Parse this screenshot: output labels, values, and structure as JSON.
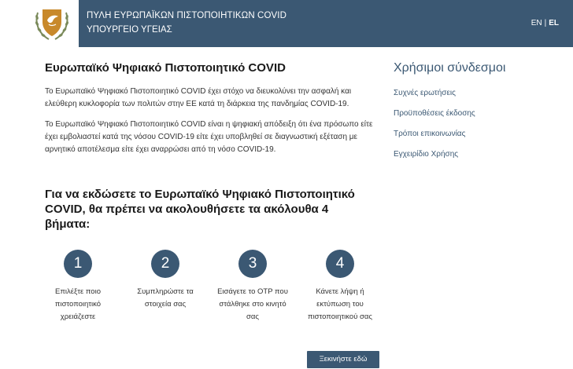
{
  "header": {
    "portal_title": "ΠΥΛΗ ΕΥΡΩΠΑΪΚΩΝ ΠΙΣΤΟΠΟΙΗΤΙΚΩΝ COVID",
    "ministry": "ΥΠΟΥΡΓΕΙΟ ΥΓΕΙΑΣ",
    "logo_icon": "cyprus-coat-of-arms-icon",
    "languages": {
      "en": "EN",
      "separator": "|",
      "el": "EL",
      "active": "EL"
    }
  },
  "main": {
    "title": "Ευρωπαϊκό Ψηφιακό Πιστοποιητικό COVID",
    "paragraphs": [
      "Το Ευρωπαϊκό Ψηφιακό Πιστοποιητικό COVID έχει στόχο να διευκολύνει την ασφαλή και ελεύθερη κυκλοφορία των πολιτών στην ΕΕ κατά τη διάρκεια της πανδημίας COVID-19.",
      "Το Ευρωπαϊκό Ψηφιακό Πιστοποιητικό COVID είναι η ψηφιακή απόδειξη ότι ένα πρόσωπο είτε έχει εμβολιαστεί κατά της νόσου COVID-19 είτε έχει υποβληθεί σε διαγνωστική εξέταση με αρνητικό αποτέλεσμα είτε έχει αναρρώσει από τη νόσο COVID-19."
    ],
    "steps_title": "Για να εκδώσετε το Ευρωπαϊκό Ψηφιακό Πιστοποιητικό COVID, θα πρέπει να ακολουθήσετε τα ακόλουθα 4 βήματα:",
    "steps": [
      {
        "number": "1",
        "text": "Επιλέξτε ποιο πιστοποιητικό χρειάζεστε"
      },
      {
        "number": "2",
        "text": "Συμπληρώστε τα στοιχεία σας"
      },
      {
        "number": "3",
        "text": "Εισάγετε το OTP που στάλθηκε στο κινητό σας"
      },
      {
        "number": "4",
        "text": "Κάνετε λήψη ή εκτύπωση του πιστοποιητικού σας"
      }
    ],
    "start_button": "Ξεκινήστε εδώ"
  },
  "sidebar": {
    "title": "Χρήσιμοι σύνδεσμοι",
    "links": [
      "Συχνές ερωτήσεις",
      "Προϋποθέσεις έκδοσης",
      "Τρόποι επικοινωνίας",
      "Εγχειρίδιο Χρήσης"
    ]
  },
  "colors": {
    "header_bg": "#3b5873",
    "accent": "#3b5873",
    "logo_gold": "#c8892b"
  }
}
